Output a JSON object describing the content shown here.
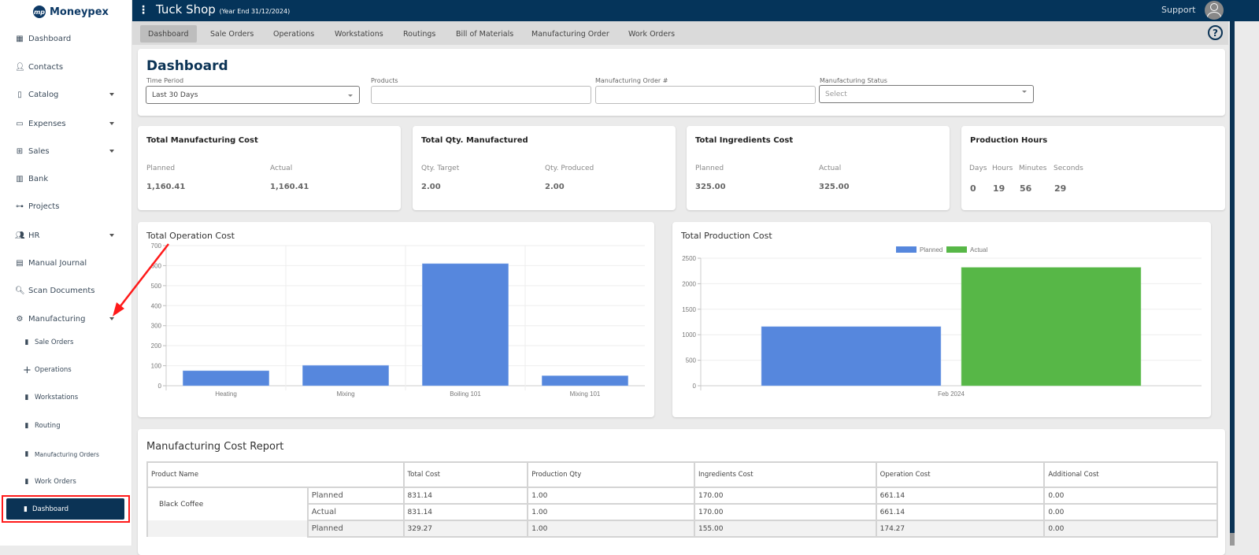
{
  "app": {
    "brand": "Moneypex",
    "company": "Tuck Shop",
    "year_end": "(Year End 31/12/2024)",
    "support_label": "Support"
  },
  "sidebar": {
    "items": [
      {
        "label": "Dashboard",
        "icon": "grid-icon",
        "expandable": false
      },
      {
        "label": "Contacts",
        "icon": "person-icon",
        "expandable": false
      },
      {
        "label": "Catalog",
        "icon": "clipboard-icon",
        "expandable": true
      },
      {
        "label": "Expenses",
        "icon": "credit-card-icon",
        "expandable": true
      },
      {
        "label": "Sales",
        "icon": "cart-icon",
        "expandable": true
      },
      {
        "label": "Bank",
        "icon": "building-icon",
        "expandable": false
      },
      {
        "label": "Projects",
        "icon": "sitemap-icon",
        "expandable": false
      },
      {
        "label": "HR",
        "icon": "users-icon",
        "expandable": true
      },
      {
        "label": "Manual Journal",
        "icon": "document-icon",
        "expandable": false
      },
      {
        "label": "Scan Documents",
        "icon": "search-icon",
        "expandable": false
      },
      {
        "label": "Manufacturing",
        "icon": "gears-icon",
        "expandable": true
      }
    ],
    "manufacturing_sub": [
      {
        "label": "Sale Orders",
        "icon": "invoice-icon"
      },
      {
        "label": "Operations",
        "icon": "plus-icon"
      },
      {
        "label": "Workstations",
        "icon": "invoice-icon"
      },
      {
        "label": "Routing",
        "icon": "invoice-icon"
      },
      {
        "label": "Manufacturing Orders",
        "icon": "invoice-icon"
      },
      {
        "label": "Work Orders",
        "icon": "invoice-icon"
      },
      {
        "label": "Dashboard",
        "icon": "invoice-icon",
        "active": true
      }
    ]
  },
  "tabs": [
    "Dashboard",
    "Sale Orders",
    "Operations",
    "Workstations",
    "Routings",
    "Bill of Materials",
    "Manufacturing Order",
    "Work Orders"
  ],
  "active_tab": "Dashboard",
  "filters": {
    "title": "Dashboard",
    "time_period": {
      "label": "Time Period",
      "value": "Last 30 Days"
    },
    "products": {
      "label": "Products",
      "value": ""
    },
    "mo_number": {
      "label": "Manufacturing Order #",
      "value": ""
    },
    "status": {
      "label": "Manufacturing Status",
      "placeholder": "Select"
    }
  },
  "stats": {
    "manufacturing_cost": {
      "title": "Total Manufacturing Cost",
      "planned_label": "Planned",
      "planned": "1,160.41",
      "actual_label": "Actual",
      "actual": "1,160.41"
    },
    "qty": {
      "title": "Total Qty. Manufactured",
      "target_label": "Qty. Target",
      "target": "2.00",
      "produced_label": "Qty. Produced",
      "produced": "2.00"
    },
    "ingredients": {
      "title": "Total Ingredients Cost",
      "planned_label": "Planned",
      "planned": "325.00",
      "actual_label": "Actual",
      "actual": "325.00"
    },
    "hours": {
      "title": "Production Hours",
      "days_label": "Days",
      "days": "0",
      "hours_label": "Hours",
      "hours": "19",
      "minutes_label": "Minutes",
      "minutes": "56",
      "seconds_label": "Seconds",
      "seconds": "29"
    }
  },
  "chart_data": [
    {
      "type": "bar",
      "title": "Total Operation Cost",
      "categories": [
        "Heating",
        "Mixing",
        "Boiling 101",
        "Mixing 101"
      ],
      "values": [
        75,
        102,
        610,
        50
      ],
      "yticks": [
        0,
        100,
        200,
        300,
        400,
        500,
        600,
        700
      ],
      "ylim": [
        0,
        700
      ],
      "xlabel": "",
      "ylabel": "",
      "grid": true,
      "color": "#5687dd"
    },
    {
      "type": "bar",
      "title": "Total Production Cost",
      "categories": [
        "Feb 2024"
      ],
      "series": [
        {
          "name": "Planned",
          "values": [
            1160
          ],
          "color": "#5687dd"
        },
        {
          "name": "Actual",
          "values": [
            2320
          ],
          "color": "#57b747"
        }
      ],
      "yticks": [
        0,
        500,
        1000,
        1500,
        2000,
        2500
      ],
      "ylim": [
        0,
        2500
      ],
      "legend": "top-center",
      "grid": true
    }
  ],
  "report": {
    "title": "Manufacturing Cost Report",
    "columns": [
      "Product Name",
      "Total Cost",
      "Production Qty",
      "Ingredients Cost",
      "Operation Cost",
      "Additional Cost"
    ],
    "rows": [
      {
        "product": "Black Coffee",
        "type": "Planned",
        "total": "831.14",
        "qty": "1.00",
        "ingredients": "170.00",
        "operation": "661.14",
        "additional": "0.00"
      },
      {
        "product": "",
        "type": "Actual",
        "total": "831.14",
        "qty": "1.00",
        "ingredients": "170.00",
        "operation": "661.14",
        "additional": "0.00"
      },
      {
        "product": "",
        "type": "Planned",
        "total": "329.27",
        "qty": "1.00",
        "ingredients": "155.00",
        "operation": "174.27",
        "additional": "0.00"
      }
    ]
  },
  "colors": {
    "primary": "#05345a",
    "planned": "#5687dd",
    "actual": "#57b747",
    "annotation": "#ff1a1a"
  }
}
